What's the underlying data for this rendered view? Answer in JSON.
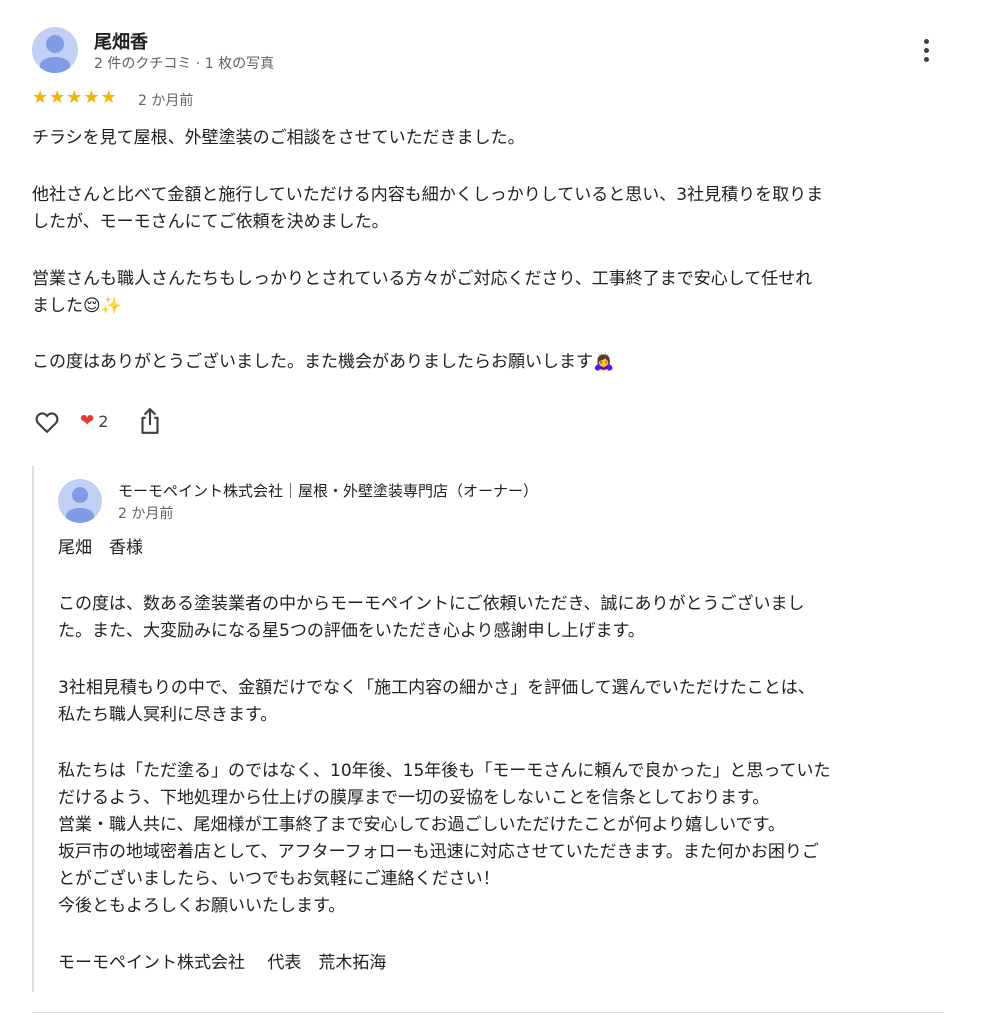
{
  "review": {
    "author": "尾畑香",
    "meta": "2 件のクチコミ · 1 枚の写真",
    "rating": 5,
    "rating_icon": "star-icon",
    "date": "2 か月前",
    "lines": [
      "チラシを見て屋根、外壁塗装のご相談をさせていただきました。",
      "他社さんと比べて金額と施行していただける内容も細かくしっかりしていると思い、3社見積りを取りま",
      "したが、モーモさんにてご依頼を決めました。",
      "営業さんも職人さんたちもしっかりとされている方々がご対応くださり、工事終了まで安心して任せれ",
      "ました😌✨",
      "この度はありがとうございました。また機会がありましたらお願いします🙇‍♀️"
    ]
  },
  "actions": {
    "like_icon": "heart-outline-icon",
    "reaction_icon": "red-heart-icon",
    "reaction_count": "2",
    "share_icon": "share-icon",
    "more_icon": "more-vert-icon"
  },
  "owner_reply": {
    "name": "モーモペイント株式会社｜屋根・外壁塗装専門店（オーナー）",
    "date": "2 か月前",
    "lines": [
      "尾畑　香様",
      "この度は、数ある塗装業者の中からモーモペイントにご依頼いただき、誠にありがとうございまし",
      "た。また、大変励みになる星5つの評価をいただき心より感謝申し上げます。",
      "3社相見積もりの中で、金額だけでなく「施工内容の細かさ」を評価して選んでいただけたことは、",
      "私たち職人冥利に尽きます。",
      "私たちは「ただ塗る」のではなく、10年後、15年後も「モーモさんに頼んで良かった」と思っていた",
      "だけるよう、下地処理から仕上げの膜厚まで一切の妥協をしないことを信条としております。",
      "営業・職人共に、尾畑様が工事終了まで安心してお過ごしいただけたことが何より嬉しいです。",
      "坂戸市の地域密着店として、アフターフォローも迅速に対応させていただきます。また何かお困りご",
      "とがございましたら、いつでもお気軽にご連絡ください！",
      "今後ともよろしくお願いいたします。",
      "モーモペイント株式会社　 代表　荒木拓海"
    ]
  }
}
